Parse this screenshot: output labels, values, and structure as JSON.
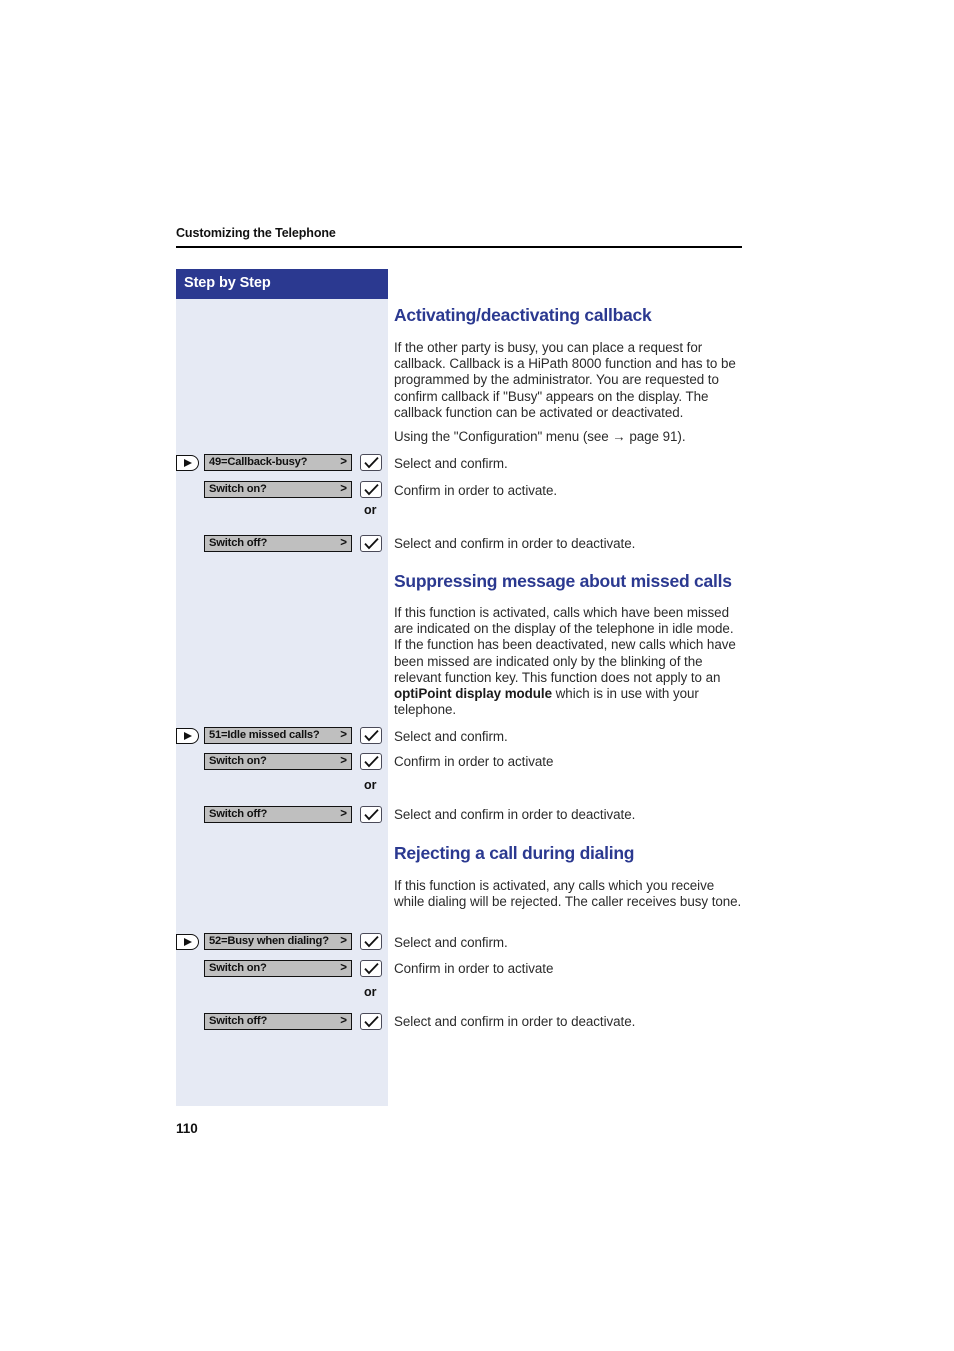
{
  "header": {
    "running_head": "Customizing the Telephone"
  },
  "sidebar": {
    "title": "Step by Step"
  },
  "folio": {
    "page_number": "110"
  },
  "icons": {
    "navigator": "navigator-key-icon",
    "confirm": "checkmark-ok-key-icon"
  },
  "colors": {
    "accent_blue": "#2b3990",
    "sidebar_bg": "#e6eaf4",
    "softkey_gray": "#bfbfbf"
  },
  "or_label": "or",
  "sections": [
    {
      "heading": "Activating/deactivating callback",
      "paragraphs": [
        "If the other party is busy, you can place a request for callback. Callback is a HiPath 8000 function and has to be programmed by the administrator. You are requested to confirm callback if \"Busy\" appears on the display. The callback function can be activated or deactivated.",
        "Using the \"Configuration\" menu (see → page 91)."
      ],
      "steps": [
        {
          "key_label": "49=Callback-busy?",
          "key_arrow": ">",
          "has_navigator": true,
          "caption": "Select and confirm."
        },
        {
          "key_label": "Switch on?",
          "key_arrow": ">",
          "has_navigator": false,
          "caption": "Confirm in order to activate."
        },
        {
          "key_label": "Switch off?",
          "key_arrow": ">",
          "has_navigator": false,
          "caption": "Select and confirm in order to deactivate."
        }
      ]
    },
    {
      "heading": "Suppressing message about missed calls",
      "paragraphs": [
        "If this function is activated, calls which have been missed are indicated on the display of the telephone in idle mode. If the function has been deactivated, new calls which have been missed are indicated only by the blinking of the relevant function key. This function does not apply to an <b>optiPoint display module</b> which is in use with your telephone."
      ],
      "steps": [
        {
          "key_label": "51=Idle missed calls?",
          "key_arrow": ">",
          "has_navigator": true,
          "caption": "Select and confirm."
        },
        {
          "key_label": "Switch on?",
          "key_arrow": ">",
          "has_navigator": false,
          "caption": "Confirm in order to activate"
        },
        {
          "key_label": "Switch off?",
          "key_arrow": ">",
          "has_navigator": false,
          "caption": "Select and confirm in order to deactivate."
        }
      ]
    },
    {
      "heading": "Rejecting a call during dialing",
      "paragraphs": [
        "If this function is activated, any calls which you receive while dialing will be rejected. The caller receives busy tone."
      ],
      "steps": [
        {
          "key_label": "52=Busy when dialing?",
          "key_arrow": ">",
          "has_navigator": true,
          "caption": "Select and confirm."
        },
        {
          "key_label": "Switch on?",
          "key_arrow": ">",
          "has_navigator": false,
          "caption": "Confirm in order to activate"
        },
        {
          "key_label": "Switch off?",
          "key_arrow": ">",
          "has_navigator": false,
          "caption": "Select and confirm in order to deactivate."
        }
      ]
    }
  ]
}
